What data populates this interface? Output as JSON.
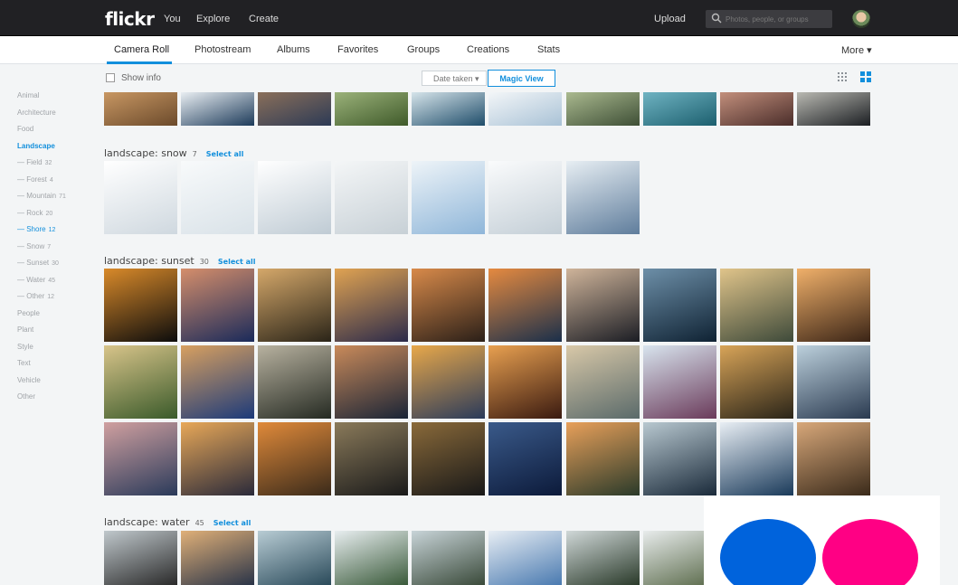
{
  "topbar": {
    "logo": "flickr",
    "nav": [
      "You",
      "Explore",
      "Create"
    ],
    "upload": "Upload",
    "search_placeholder": "Photos, people, or groups"
  },
  "subnav": {
    "tabs": [
      "Camera Roll",
      "Photostream",
      "Albums",
      "Favorites",
      "Groups",
      "Creations",
      "Stats"
    ],
    "active": "Camera Roll",
    "more": "More ▾"
  },
  "toolbar": {
    "show_info": "Show info",
    "date_taken": "Date taken ▾",
    "magic_view": "Magic View"
  },
  "sidebar": [
    {
      "label": "Animal"
    },
    {
      "label": "Architecture"
    },
    {
      "label": "Food"
    },
    {
      "label": "Landscape",
      "state": "active"
    },
    {
      "label": "— Field",
      "count": "32"
    },
    {
      "label": "— Forest",
      "count": "4"
    },
    {
      "label": "— Mountain",
      "count": "71"
    },
    {
      "label": "— Rock",
      "count": "20"
    },
    {
      "label": "— Shore",
      "count": "12",
      "state": "sub-active"
    },
    {
      "label": "— Snow",
      "count": "7"
    },
    {
      "label": "— Sunset",
      "count": "30"
    },
    {
      "label": "— Water",
      "count": "45"
    },
    {
      "label": "— Other",
      "count": "12"
    },
    {
      "label": "People"
    },
    {
      "label": "Plant"
    },
    {
      "label": "Style"
    },
    {
      "label": "Text"
    },
    {
      "label": "Vehicle"
    },
    {
      "label": "Other"
    }
  ],
  "sections": [
    {
      "name": "landscape: snow",
      "count": "7",
      "select_all": "Select all"
    },
    {
      "name": "landscape: sunset",
      "count": "30",
      "select_all": "Select all"
    },
    {
      "name": "landscape: water",
      "count": "45",
      "select_all": "Select all"
    }
  ],
  "colors": {
    "accent": "#128fdc",
    "topbar": "#212124",
    "brand_blue": "#0063dc",
    "brand_pink": "#ff0084"
  }
}
